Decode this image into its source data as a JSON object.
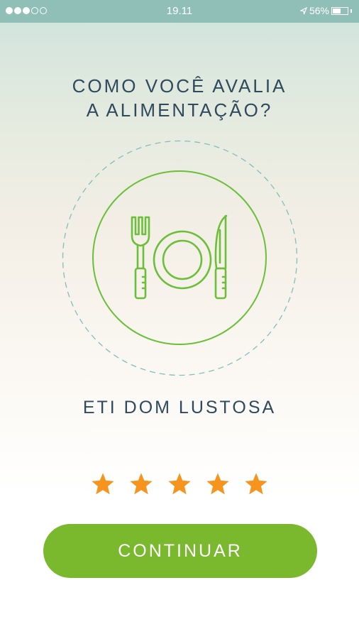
{
  "status_bar": {
    "time": "19.11",
    "battery_percent": "56%",
    "battery_level": 0.56,
    "signal_bars_filled": 3,
    "signal_bars_total": 5
  },
  "question": {
    "line1": "COMO VOCÊ AVALIA",
    "line2": "A ALIMENTAÇÃO?"
  },
  "icon": "plate-fork-knife-icon",
  "venue_name": "ETI DOM LUSTOSA",
  "rating": {
    "max": 5,
    "value": 5
  },
  "continue_label": "CONTINUAR",
  "colors": {
    "status_bar": "#8fbfb7",
    "text": "#2e4a5c",
    "icon_green": "#6cbf3a",
    "ring_dashes": "#7fc0b8",
    "star": "#f7941d",
    "button": "#7ab82e"
  }
}
